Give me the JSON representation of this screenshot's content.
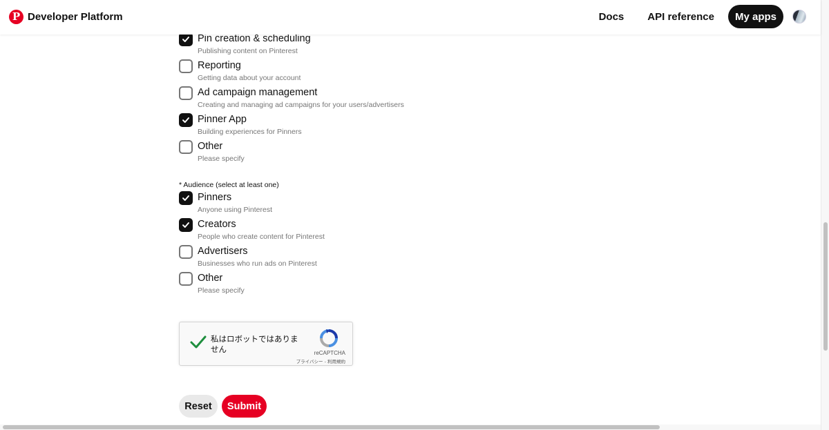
{
  "header": {
    "logo_letter": "P",
    "brand": "Developer Platform",
    "nav": {
      "docs": "Docs",
      "api_reference": "API reference",
      "my_apps": "My apps"
    }
  },
  "use_case_options": [
    {
      "label": "Pin creation & scheduling",
      "sub": "Publishing content on Pinterest",
      "checked": true
    },
    {
      "label": "Reporting",
      "sub": "Getting data about your account",
      "checked": false
    },
    {
      "label": "Ad campaign management",
      "sub": "Creating and managing ad campaigns for your users/advertisers",
      "checked": false
    },
    {
      "label": "Pinner App",
      "sub": "Building experiences for Pinners",
      "checked": true
    },
    {
      "label": "Other",
      "sub": "Please specify",
      "checked": false
    }
  ],
  "audience": {
    "label": "* Audience (select at least one)",
    "options": [
      {
        "label": "Pinners",
        "sub": "Anyone using Pinterest",
        "checked": true
      },
      {
        "label": "Creators",
        "sub": "People who create content for Pinterest",
        "checked": true
      },
      {
        "label": "Advertisers",
        "sub": "Businesses who run ads on Pinterest",
        "checked": false
      },
      {
        "label": "Other",
        "sub": "Please specify",
        "checked": false
      }
    ]
  },
  "recaptcha": {
    "text": "私はロボットではありません",
    "brand": "reCAPTCHA",
    "links": "プライバシー - 利用規約",
    "checked": true
  },
  "buttons": {
    "reset": "Reset",
    "submit": "Submit"
  },
  "colors": {
    "accent": "#e60023",
    "dark": "#111111",
    "muted": "#767676"
  }
}
